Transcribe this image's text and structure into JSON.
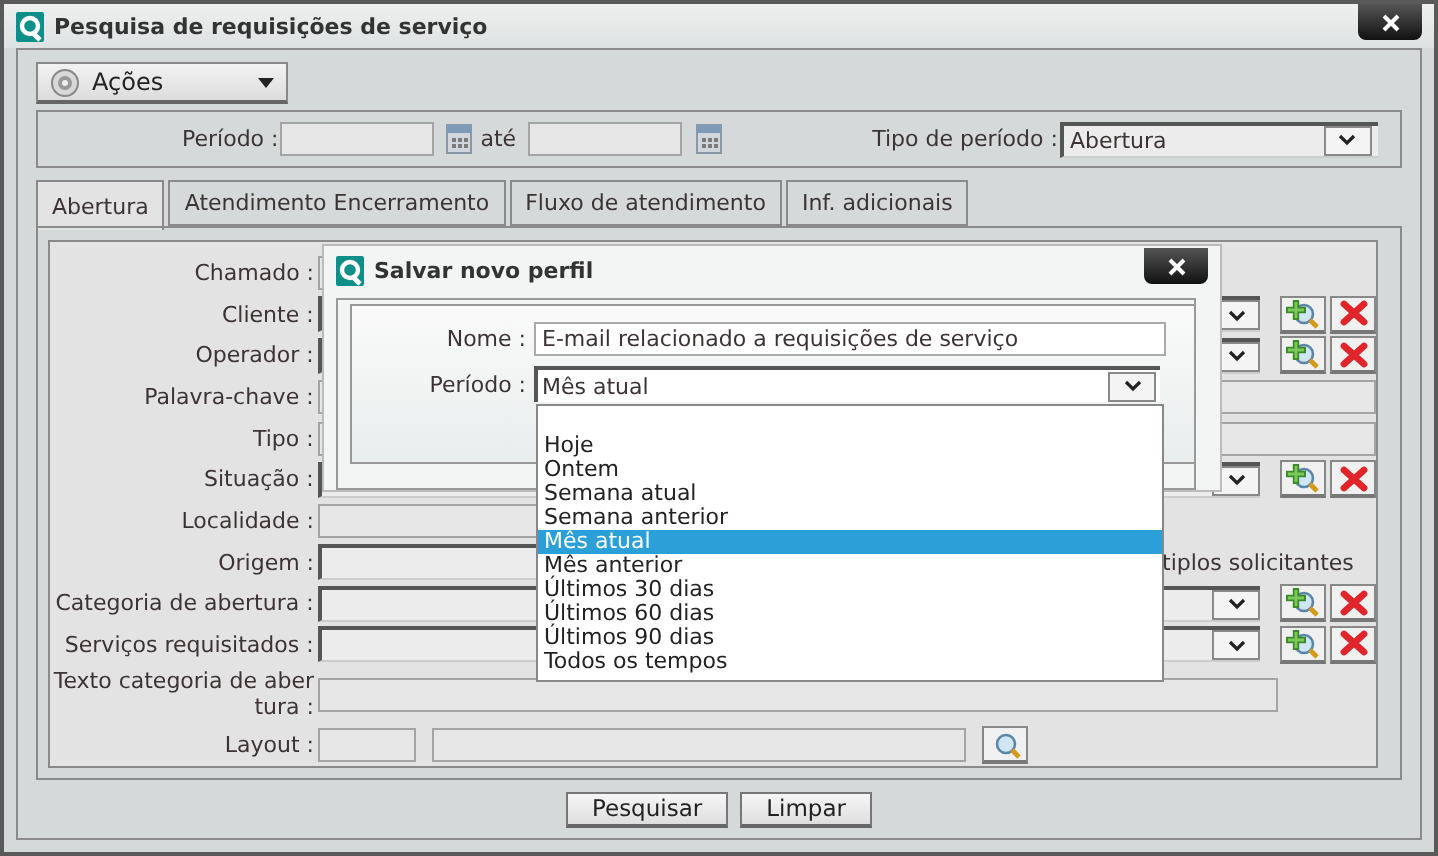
{
  "window": {
    "title": "Pesquisa de requisições de serviço"
  },
  "actions_menu": {
    "label": "Ações"
  },
  "period_bar": {
    "period_label": "Período :",
    "until_label": "até",
    "type_label": "Tipo de período :",
    "type_value": "Abertura"
  },
  "tabs": [
    {
      "label": "Abertura",
      "selected": true
    },
    {
      "label": "Atendimento Encerramento",
      "selected": false
    },
    {
      "label": "Fluxo de atendimento",
      "selected": false
    },
    {
      "label": "Inf. adicionais",
      "selected": false
    }
  ],
  "form_rows": [
    {
      "label": "Chamado :",
      "kind": "text"
    },
    {
      "label": "Cliente :",
      "kind": "select"
    },
    {
      "label": "Operador :",
      "kind": "select"
    },
    {
      "label": "Palavra-chave :",
      "kind": "wide"
    },
    {
      "label": "Tipo :",
      "kind": "wide"
    },
    {
      "label": "Situação :",
      "kind": "select"
    },
    {
      "label": "Localidade :",
      "kind": "text"
    },
    {
      "label": "Origem :",
      "kind": "note",
      "note": "tiplos solicitantes"
    },
    {
      "label": "Categoria de abertura :",
      "kind": "select"
    },
    {
      "label": "Serviços requisitados :",
      "kind": "select"
    },
    {
      "label": "Texto categoria de abertura :",
      "kind": "long"
    },
    {
      "label": "Layout :",
      "kind": "layout"
    }
  ],
  "buttons": [
    "Pesquisar",
    "Limpar"
  ],
  "dialog": {
    "title": "Salvar novo perfil",
    "name_label": "Nome :",
    "name_value": "E-mail relacionado a requisições de serviço",
    "period_label": "Período :",
    "period_value": "Mês atual",
    "options": [
      {
        "label": "Hoje",
        "selected": false
      },
      {
        "label": "Ontem",
        "selected": false
      },
      {
        "label": "Semana atual",
        "selected": false
      },
      {
        "label": "Semana anterior",
        "selected": false
      },
      {
        "label": "Mês atual",
        "selected": true
      },
      {
        "label": "Mês anterior",
        "selected": false
      },
      {
        "label": "Últimos 30 dias",
        "selected": false
      },
      {
        "label": "Últimos 60 dias",
        "selected": false
      },
      {
        "label": "Últimos 90 dias",
        "selected": false
      },
      {
        "label": "Todos os tempos",
        "selected": false
      }
    ]
  }
}
